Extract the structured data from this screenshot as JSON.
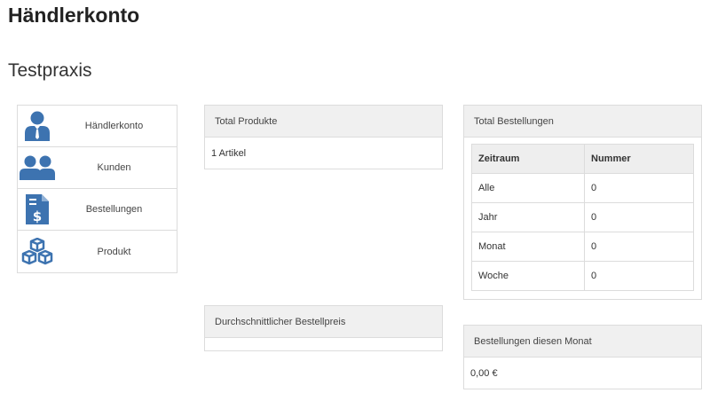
{
  "page": {
    "title": "Händlerkonto",
    "subtitle": "Testpraxis"
  },
  "menu": {
    "items": [
      {
        "label": "Händlerkonto",
        "icon": "merchant-user-icon"
      },
      {
        "label": "Kunden",
        "icon": "customers-icon"
      },
      {
        "label": "Bestellungen",
        "icon": "invoice-icon"
      },
      {
        "label": "Produkt",
        "icon": "boxes-icon"
      }
    ],
    "icon_color": "#3d73b0"
  },
  "products": {
    "heading": "Total Produkte",
    "value": "1 Artikel"
  },
  "avg_price": {
    "heading": "Durchschnittlicher Bestellpreis",
    "value": ""
  },
  "orders": {
    "heading": "Total Bestellungen",
    "columns": [
      "Zeitraum",
      "Nummer"
    ],
    "rows": [
      {
        "period": "Alle",
        "count": "0"
      },
      {
        "period": "Jahr",
        "count": "0"
      },
      {
        "period": "Monat",
        "count": "0"
      },
      {
        "period": "Woche",
        "count": "0"
      }
    ]
  },
  "month_orders": {
    "heading": "Bestellungen diesen Monat",
    "value": "0,00 €"
  }
}
